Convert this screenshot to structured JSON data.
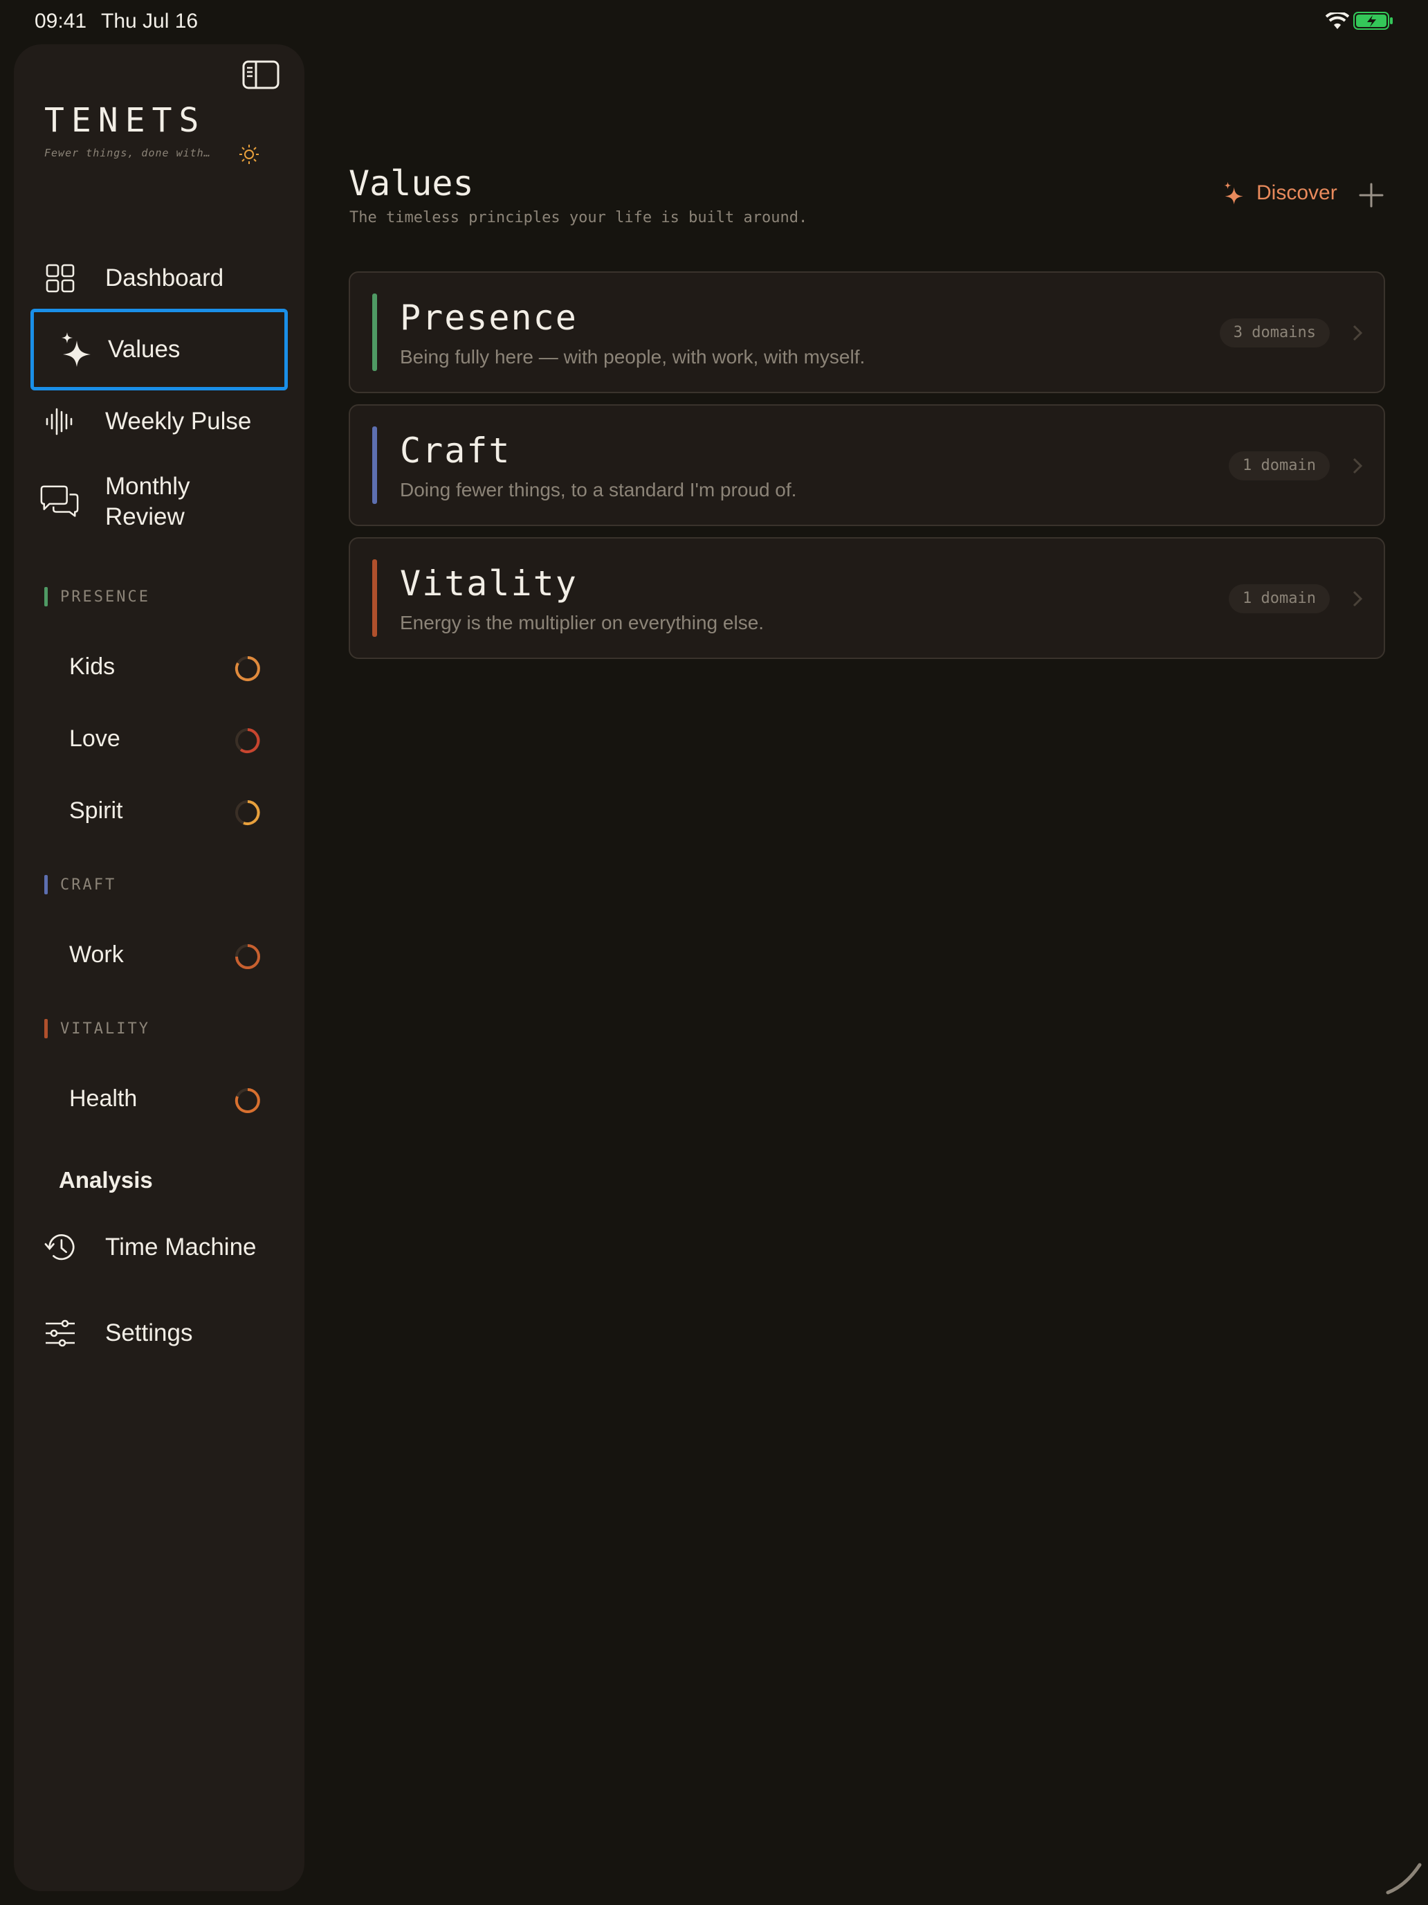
{
  "status": {
    "time": "09:41",
    "date": "Thu Jul 16"
  },
  "brand": {
    "title": "TENETS",
    "subtitle": "Fewer things, done with…"
  },
  "nav": [
    {
      "label": "Dashboard",
      "icon": "grid-icon"
    },
    {
      "label": "Values",
      "icon": "sparkles-icon",
      "selected": true
    },
    {
      "label": "Weekly Pulse",
      "icon": "waveform-icon"
    },
    {
      "label": "Monthly Review",
      "icon": "chat-bubbles-icon"
    }
  ],
  "sections": [
    {
      "label": "PRESENCE",
      "color": "#4f9a64",
      "domains": [
        {
          "label": "Kids",
          "ring_color": "#e08a3c"
        },
        {
          "label": "Love",
          "ring_color": "#c8452f"
        },
        {
          "label": "Spirit",
          "ring_color": "#e8a03c"
        }
      ]
    },
    {
      "label": "CRAFT",
      "color": "#5d6fb0",
      "domains": [
        {
          "label": "Work",
          "ring_color": "#c8602f"
        }
      ]
    },
    {
      "label": "VITALITY",
      "color": "#b0502c",
      "domains": [
        {
          "label": "Health",
          "ring_color": "#d8702f"
        }
      ]
    }
  ],
  "analysis": {
    "title": "Analysis",
    "items": [
      {
        "label": "Time Machine",
        "icon": "history-icon"
      },
      {
        "label": "Settings",
        "icon": "sliders-icon"
      }
    ]
  },
  "main": {
    "title": "Values",
    "subtitle": "The timeless principles your life is built around.",
    "discover_label": "Discover",
    "values": [
      {
        "name": "Presence",
        "description": "Being fully here — with people, with work, with myself.",
        "badge": "3 domains",
        "color": "#4f9a64"
      },
      {
        "name": "Craft",
        "description": "Doing fewer things, to a standard I'm proud of.",
        "badge": "1 domain",
        "color": "#5d6fb0"
      },
      {
        "name": "Vitality",
        "description": "Energy is the multiplier on everything else.",
        "badge": "1 domain",
        "color": "#b0502c"
      }
    ]
  },
  "colors": {
    "accent": "#e88a5c",
    "selection": "#1a8fe8",
    "background": "#16140f",
    "sidebar": "#211c18"
  }
}
